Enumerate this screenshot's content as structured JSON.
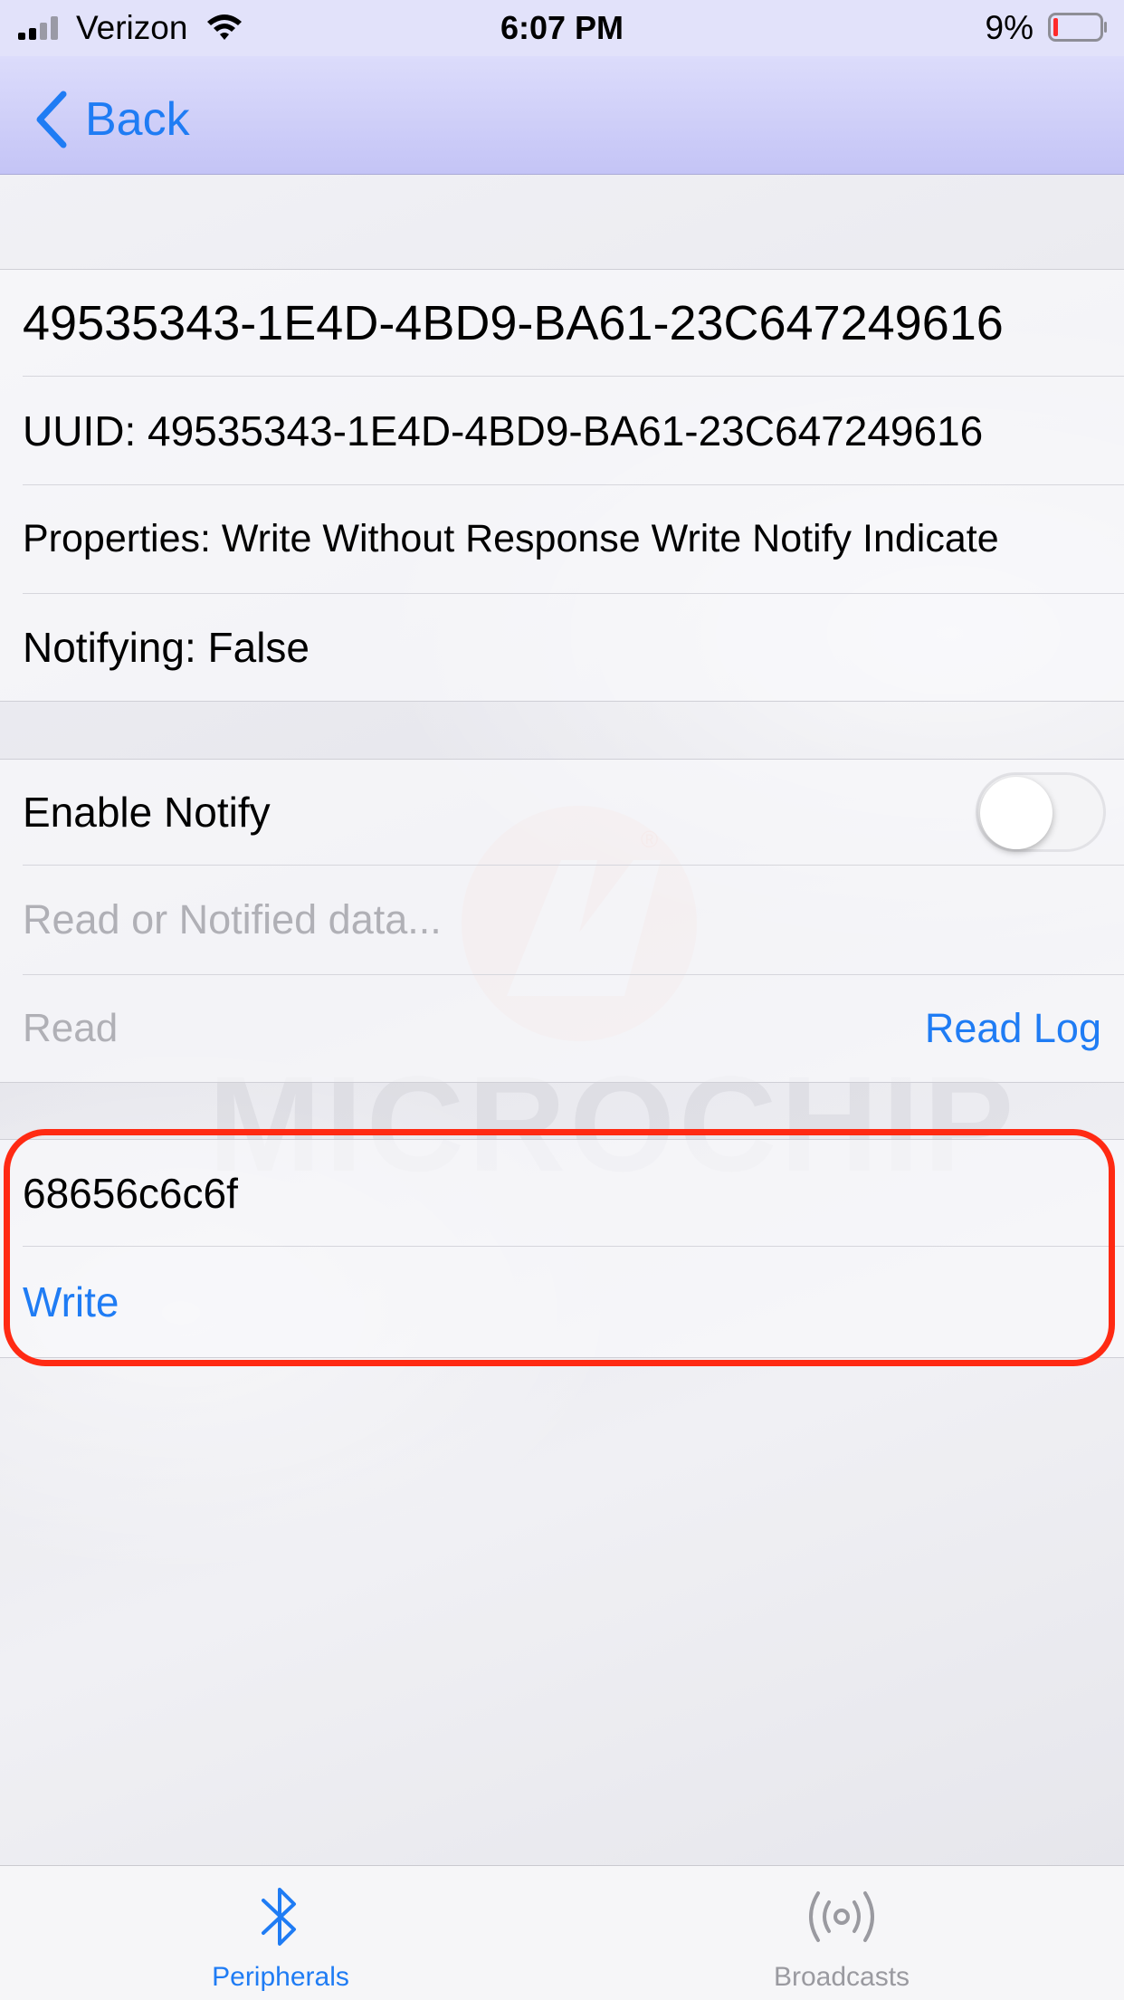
{
  "status_bar": {
    "carrier": "Verizon",
    "time": "6:07 PM",
    "battery_percent": "9%"
  },
  "nav": {
    "back_label": "Back"
  },
  "characteristic": {
    "name": "49535343-1E4D-4BD9-BA61-23C647249616",
    "uuid_line": "UUID: 49535343-1E4D-4BD9-BA61-23C647249616",
    "properties_line": "Properties: Write Without Response Write Notify Indicate",
    "notifying_line": "Notifying: False"
  },
  "notify_section": {
    "enable_notify_label": "Enable Notify",
    "enable_notify_on": false,
    "data_placeholder": "Read or Notified data...",
    "read_label": "Read",
    "read_log_label": "Read Log"
  },
  "write_section": {
    "write_value": "68656c6c6f",
    "write_label": "Write"
  },
  "watermark": {
    "text": "MICROCHIP",
    "registered": "®"
  },
  "tab_bar": {
    "tabs": [
      {
        "label": "Peripherals",
        "icon": "bluetooth-icon",
        "active": true
      },
      {
        "label": "Broadcasts",
        "icon": "broadcast-icon",
        "active": false
      }
    ]
  },
  "colors": {
    "accent": "#1f7cf4",
    "highlight_border": "#ff2a13",
    "nav_gradient_top": "#dcdcfb",
    "nav_gradient_bottom": "#c4c4f6"
  }
}
